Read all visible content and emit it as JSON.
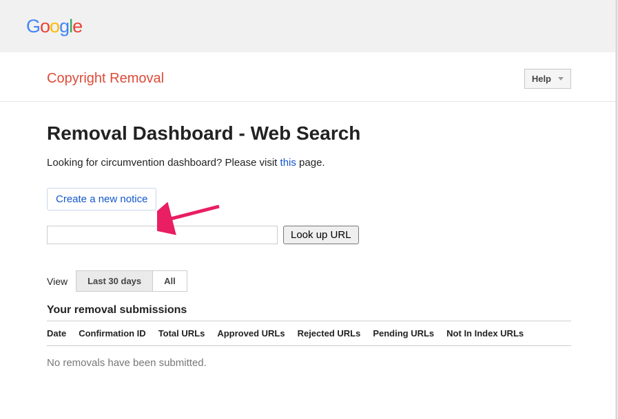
{
  "logo": {
    "g1": "G",
    "o1": "o",
    "o2": "o",
    "g2": "g",
    "l": "l",
    "e": "e"
  },
  "header": {
    "page_type": "Copyright Removal",
    "help_label": "Help"
  },
  "main": {
    "title": "Removal Dashboard - Web Search",
    "subtext_before": "Looking for circumvention dashboard? Please visit ",
    "subtext_link": "this",
    "subtext_after": " page.",
    "create_notice_label": "Create a new notice",
    "lookup_button_label": "Look up URL",
    "view_label": "View",
    "tabs": [
      {
        "label": "Last 30 days"
      },
      {
        "label": "All"
      }
    ],
    "submissions_title": "Your removal submissions",
    "columns": [
      "Date",
      "Confirmation ID",
      "Total URLs",
      "Approved URLs",
      "Rejected URLs",
      "Pending URLs",
      "Not In Index URLs"
    ],
    "empty_message": "No removals have been submitted."
  }
}
